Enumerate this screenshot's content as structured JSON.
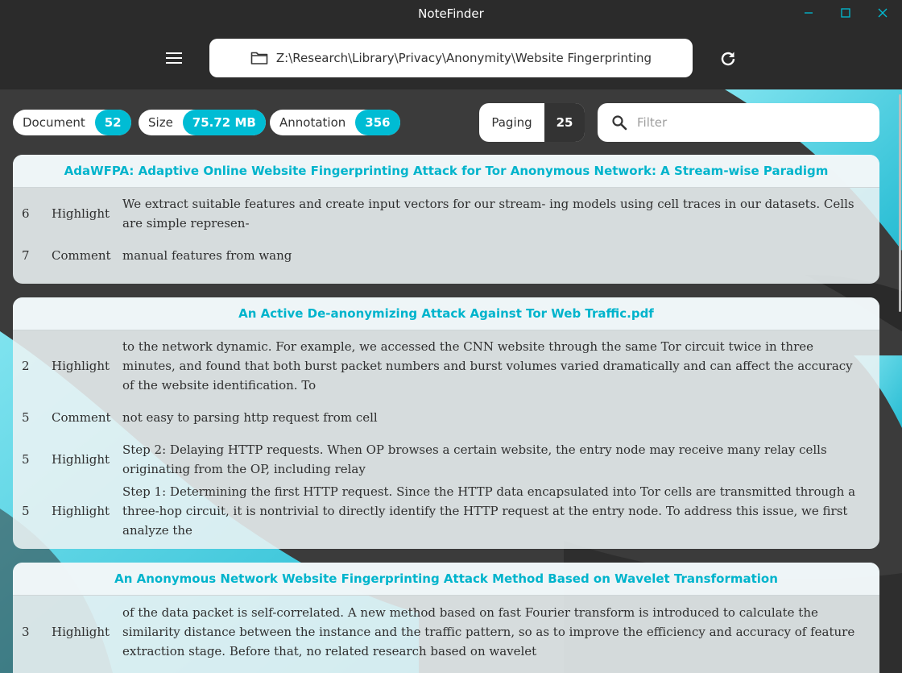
{
  "window": {
    "title": "NoteFinder",
    "controls": [
      "minimize-icon",
      "maximize-icon",
      "close-icon"
    ],
    "accent_color": "#00bcd4"
  },
  "toolbar": {
    "menu_icon": "hamburger-icon",
    "folder_icon": "folder-icon",
    "path": "Z:\\Research\\Library\\Privacy\\Anonymity\\Website Fingerprinting",
    "refresh_icon": "refresh-icon"
  },
  "stats": {
    "document": {
      "label": "Document",
      "value": "52"
    },
    "size": {
      "label": "Size",
      "value": "75.72 MB"
    },
    "annotation": {
      "label": "Annotation",
      "value": "356"
    }
  },
  "paging": {
    "label": "Paging",
    "value": "25"
  },
  "filter": {
    "placeholder": "Filter",
    "value": "",
    "icon": "search-icon"
  },
  "documents": [
    {
      "title": "AdaWFPA: Adaptive Online Website Fingerprinting Attack for Tor Anonymous Network: A Stream-wise Paradigm",
      "annotations": [
        {
          "page": "6",
          "type": "Highlight",
          "text": "We extract suitable features and create input vectors for our stream- ing models using cell traces in our datasets. Cells are simple represen-"
        },
        {
          "page": "7",
          "type": "Comment",
          "text": "manual features from wang"
        }
      ]
    },
    {
      "title": "An Active De-anonymizing Attack Against Tor Web Traffic.pdf",
      "annotations": [
        {
          "page": "2",
          "type": "Highlight",
          "text": "to the network dynamic. For example, we accessed the CNN website through the same Tor circuit twice in three minutes, and found that both burst packet numbers and burst volumes varied dramatically and can affect the accuracy of the website identification. To"
        },
        {
          "page": "5",
          "type": "Comment",
          "text": "not easy to parsing http request from cell"
        },
        {
          "page": "5",
          "type": "Highlight",
          "text": "Step 2: Delaying HTTP requests. When OP browses a certain website, the entry node may receive many relay cells originating from the OP, including relay"
        },
        {
          "page": "5",
          "type": "Highlight",
          "text": "Step 1: Determining the first HTTP request. Since the HTTP data encapsulated into Tor cells are transmitted through a three-hop circuit, it is nontrivial to directly identify the HTTP request at the entry node. To address this issue, we first analyze the"
        }
      ]
    },
    {
      "title": "An Anonymous Network Website Fingerprinting Attack Method Based on Wavelet Transformation",
      "annotations": [
        {
          "page": "3",
          "type": "Highlight",
          "text": "of the data packet is self-correlated. A new method based on fast Fourier transform is introduced to calculate the similarity distance between the instance and the traffic pattern, so as to improve the efficiency and accuracy of feature extraction stage. Before that, no related research based on wavelet"
        }
      ]
    }
  ]
}
